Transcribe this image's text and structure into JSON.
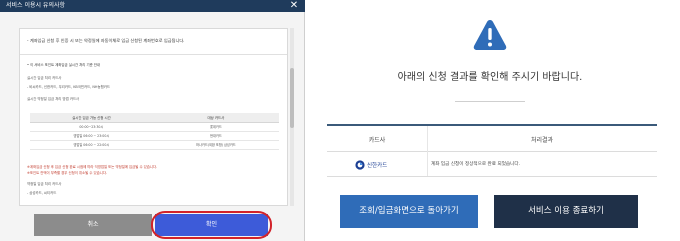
{
  "modal": {
    "title": "서비스 이용시 유의사항",
    "close_icon": "close-icon",
    "intro": "- 계좌입금 신청 후 인증 시 또는 약정일에 자동이체로 입금 신청된 계좌번호로 입금됩니다.",
    "lines": [
      "• 이 서비스 포인트 계좌입금 실시간 처리 기준 안내",
      "실시간 입금 처리 카드사",
      "- 비씨카드, 신한카드, 우리카드, KB국민카드, NH농협카드",
      "실시간 약정일 입금 처리 방법 카드사"
    ],
    "table": {
      "headers": [
        "실시간 입금 가능 신청 시간",
        "대상 카드사"
      ],
      "rows": [
        [
          "00:00~23:30시",
          "롯데카드"
        ],
        [
          "영업일 06:00 ~ 23:00시",
          "현대카드"
        ],
        [
          "영업일 06:00 ~ 22:00시",
          "하나카드(외환 포함) 삼성카드"
        ]
      ]
    },
    "footnotes": [
      "※계좌입금 신청 후 입금 신청 완료 시점에 따라 익영업일 또는 약정일에 입금될 수 있습니다.",
      "※포인트 잔액이 부족할 경우 신청이 취소될 수 있습니다.",
      "약정일 입금 처리 카드사",
      "- 삼성카드, 씨티카드"
    ],
    "cancel_label": "취소",
    "confirm_label": "확인",
    "highlight_color": "#d2232a"
  },
  "result": {
    "alert_icon": "warning-triangle-icon",
    "headline": "아래의 신청 결과를 확인해 주시기 바랍니다.",
    "table": {
      "col_card": "카드사",
      "col_result": "처리결과",
      "row": {
        "card_icon": "shinhan-logo-icon",
        "card_name": "신한카드",
        "result_text": "계좌 입금 신청이 정상적으로 완료 되었습니다."
      }
    },
    "back_button": "조회/입금화면으로 돌아가기",
    "exit_button": "서비스 이용 종료하기"
  },
  "colors": {
    "header_navy": "#1f3b5c",
    "confirm_blue": "#3d5bd9",
    "back_blue": "#2f6cb8",
    "exit_navy": "#1f3048",
    "alert_blue": "#2f6cb8"
  }
}
